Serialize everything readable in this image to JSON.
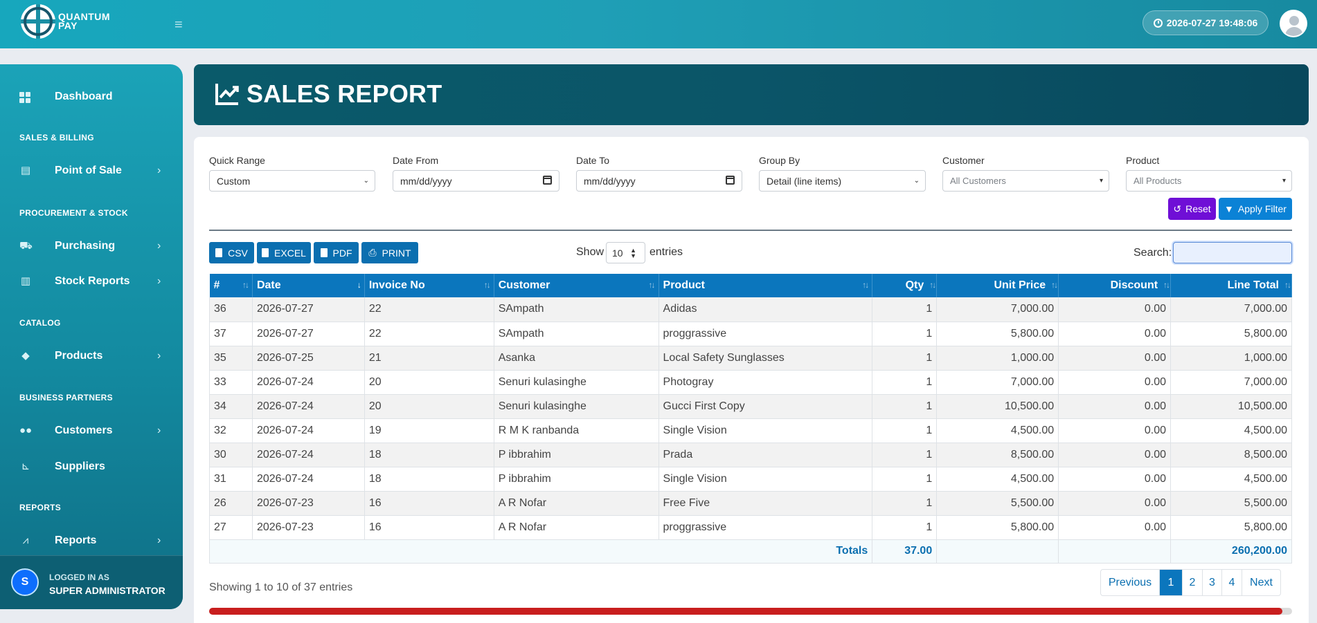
{
  "app": {
    "logo_line1": "QUANTUM",
    "logo_line2": "PAY"
  },
  "topbar": {
    "datetime": "2026-07-27 19:48:06"
  },
  "sidebar": {
    "items": [
      {
        "label": "Dashboard",
        "icon": "dashboard-icon"
      },
      {
        "label": "Point of Sale",
        "icon": "cash-register-icon"
      },
      {
        "label": "Purchasing",
        "icon": "truck-icon"
      },
      {
        "label": "Stock Reports",
        "icon": "warehouse-icon"
      },
      {
        "label": "Products",
        "icon": "tags-icon"
      },
      {
        "label": "Customers",
        "icon": "users-icon"
      },
      {
        "label": "Suppliers",
        "icon": "dolly-icon"
      },
      {
        "label": "Reports",
        "icon": "chart-line-icon"
      }
    ],
    "sections": [
      "SALES & BILLING",
      "PROCUREMENT & STOCK",
      "CATALOG",
      "BUSINESS PARTNERS",
      "REPORTS"
    ],
    "footer": {
      "avatar_letter": "S",
      "logged_in_as": "LOGGED IN AS",
      "role": "SUPER ADMINISTRATOR"
    }
  },
  "page": {
    "title": "SALES REPORT"
  },
  "filters": {
    "quick_range": {
      "label": "Quick Range",
      "value": "Custom"
    },
    "date_from": {
      "label": "Date From",
      "value": "mm/dd/yyyy"
    },
    "date_to": {
      "label": "Date To",
      "value": "mm/dd/yyyy"
    },
    "group_by": {
      "label": "Group By",
      "value": "Detail (line items)"
    },
    "customer": {
      "label": "Customer",
      "placeholder": "All Customers"
    },
    "product": {
      "label": "Product",
      "placeholder": "All Products"
    },
    "reset_label": "Reset",
    "apply_label": "Apply Filter"
  },
  "export": {
    "csv": "CSV",
    "excel": "EXCEL",
    "pdf": "PDF",
    "print": "PRINT"
  },
  "length": {
    "show": "Show",
    "value": "10",
    "entries": "entries"
  },
  "search": {
    "label": "Search:"
  },
  "table": {
    "headers": [
      "#",
      "Date",
      "Invoice No",
      "Customer",
      "Product",
      "Qty",
      "Unit Price",
      "Discount",
      "Line Total"
    ],
    "rows": [
      [
        "36",
        "2026-07-27",
        "22",
        "SAmpath",
        "Adidas",
        "1",
        "7,000.00",
        "0.00",
        "7,000.00"
      ],
      [
        "37",
        "2026-07-27",
        "22",
        "SAmpath",
        "proggrassive",
        "1",
        "5,800.00",
        "0.00",
        "5,800.00"
      ],
      [
        "35",
        "2026-07-25",
        "21",
        "Asanka",
        "Local Safety Sunglasses",
        "1",
        "1,000.00",
        "0.00",
        "1,000.00"
      ],
      [
        "33",
        "2026-07-24",
        "20",
        "Senuri kulasinghe",
        "Photogray",
        "1",
        "7,000.00",
        "0.00",
        "7,000.00"
      ],
      [
        "34",
        "2026-07-24",
        "20",
        "Senuri kulasinghe",
        "Gucci First Copy",
        "1",
        "10,500.00",
        "0.00",
        "10,500.00"
      ],
      [
        "32",
        "2026-07-24",
        "19",
        "R M K ranbanda",
        "Single Vision",
        "1",
        "4,500.00",
        "0.00",
        "4,500.00"
      ],
      [
        "30",
        "2026-07-24",
        "18",
        "P ibbrahim",
        "Prada",
        "1",
        "8,500.00",
        "0.00",
        "8,500.00"
      ],
      [
        "31",
        "2026-07-24",
        "18",
        "P ibbrahim",
        "Single Vision",
        "1",
        "4,500.00",
        "0.00",
        "4,500.00"
      ],
      [
        "26",
        "2026-07-23",
        "16",
        "A R Nofar",
        "Free Five",
        "1",
        "5,500.00",
        "0.00",
        "5,500.00"
      ],
      [
        "27",
        "2026-07-23",
        "16",
        "A R Nofar",
        "proggrassive",
        "1",
        "5,800.00",
        "0.00",
        "5,800.00"
      ]
    ],
    "totals": {
      "label": "Totals",
      "qty": "37.00",
      "line_total": "260,200.00"
    }
  },
  "footer": {
    "showing": "Showing 1 to 10 of 37 entries",
    "pages": [
      "Previous",
      "1",
      "2",
      "3",
      "4",
      "Next"
    ],
    "active_page": "1"
  },
  "colors": {
    "accent": "#0b76bd",
    "banner": "#0a5a6a",
    "reset": "#6f0fd6",
    "apply": "#0b82d6"
  }
}
